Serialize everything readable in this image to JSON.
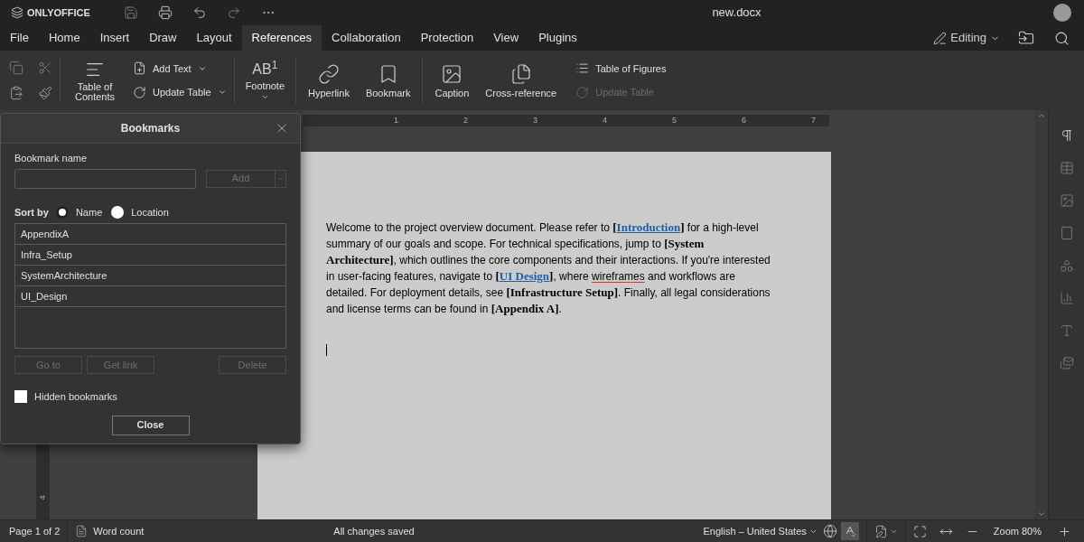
{
  "app": {
    "logo": "ONLYOFFICE",
    "title": "new.docx",
    "mode": "Editing"
  },
  "menu_tabs": [
    {
      "label": "File",
      "selected": false
    },
    {
      "label": "Home",
      "selected": false
    },
    {
      "label": "Insert",
      "selected": false
    },
    {
      "label": "Draw",
      "selected": false
    },
    {
      "label": "Layout",
      "selected": false
    },
    {
      "label": "References",
      "selected": true
    },
    {
      "label": "Collaboration",
      "selected": false
    },
    {
      "label": "Protection",
      "selected": false
    },
    {
      "label": "View",
      "selected": false
    },
    {
      "label": "Plugins",
      "selected": false
    }
  ],
  "ribbon": {
    "table_of_contents": "Table of Contents",
    "add_text": "Add Text",
    "update_table": "Update Table",
    "footnote_glyph": "AB$^{1}$",
    "footnote": "Footnote",
    "hyperlink": "Hyperlink",
    "bookmark": "Bookmark",
    "caption": "Caption",
    "cross_reference": "Cross-reference",
    "table_of_figures": "Table of Figures",
    "update_figures_table": {
      "label": "Update Table",
      "disabled": true
    }
  },
  "ruler": {
    "numbers": [
      "1",
      "2",
      "3",
      "4",
      "5",
      "6",
      "7"
    ],
    "vertical_numbers": [
      "4"
    ]
  },
  "document": {
    "runs": [
      {
        "kind": "text",
        "text": "Welcome to the project overview document. Please refer to "
      },
      {
        "kind": "ref",
        "text": "["
      },
      {
        "kind": "link",
        "text": "Introduction"
      },
      {
        "kind": "ref",
        "text": "]"
      },
      {
        "kind": "text",
        "text": " for a high-level summary of our goals and scope. For technical specifications, jump to "
      },
      {
        "kind": "ref",
        "text": "[System Architecture]"
      },
      {
        "kind": "text",
        "text": ", which outlines the core components and their interactions. If you're interested in user-facing features, navigate to "
      },
      {
        "kind": "ref",
        "text": "["
      },
      {
        "kind": "link",
        "text": "UI Design"
      },
      {
        "kind": "ref",
        "text": "]"
      },
      {
        "kind": "text",
        "text": ", where "
      },
      {
        "kind": "misspelled",
        "text": "wireframes"
      },
      {
        "kind": "text",
        "text": " and workflows are detailed. For deployment details, see "
      },
      {
        "kind": "ref",
        "text": "[Infrastructure Setup]"
      },
      {
        "kind": "text",
        "text": ". Finally, all legal considerations and license terms can be found in "
      },
      {
        "kind": "ref",
        "text": "[Appendix A]"
      },
      {
        "kind": "text",
        "text": "."
      }
    ]
  },
  "dialog": {
    "title": "Bookmarks",
    "name_label": "Bookmark name",
    "add": {
      "label": "Add",
      "disabled": true
    },
    "sort_label": "Sort by",
    "sort_options": [
      {
        "label": "Name",
        "selected": true
      },
      {
        "label": "Location",
        "selected": false
      }
    ],
    "bookmarks": [
      {
        "name": "AppendixA",
        "selected": false
      },
      {
        "name": "Infra_Setup",
        "selected": false
      },
      {
        "name": "SystemArchitecture",
        "selected": false
      },
      {
        "name": "UI_Design",
        "selected": false
      }
    ],
    "actions": [
      {
        "label": "Go to",
        "disabled": true
      },
      {
        "label": "Get link",
        "disabled": true
      },
      {
        "label": "Delete",
        "disabled": true
      }
    ],
    "hidden_bookmarks": {
      "label": "Hidden bookmarks",
      "checked": false
    },
    "close": "Close"
  },
  "status_bar": {
    "page": "Page 1 of 2",
    "word_count": "Word count",
    "save_state": "All changes saved",
    "language": "English – United States",
    "spellcheck_on": true,
    "zoom": "Zoom 80%"
  }
}
